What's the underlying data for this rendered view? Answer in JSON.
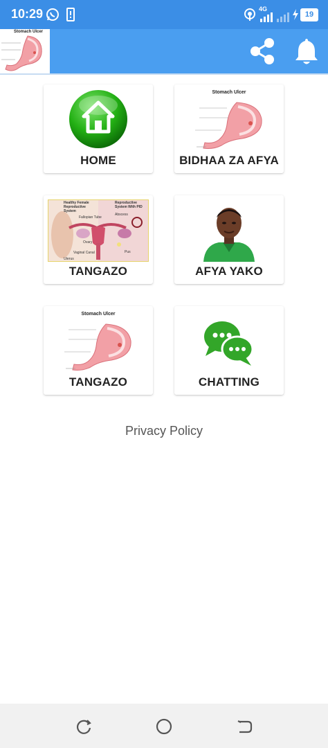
{
  "status_bar": {
    "time": "10:29",
    "network": "4G",
    "battery": "19",
    "icons": [
      "whatsapp-icon",
      "sim-alert-icon",
      "hotspot-icon",
      "signal-icon",
      "charging-icon",
      "battery-icon"
    ]
  },
  "app_bar": {
    "logo": {
      "title": "Stomach Ulcer",
      "icon": "stomach-ulcer-logo"
    },
    "actions": [
      {
        "name": "share",
        "icon": "share-icon"
      },
      {
        "name": "notifications",
        "icon": "bell-icon"
      }
    ],
    "color": "#4a9ef0"
  },
  "tiles": [
    {
      "label": "HOME",
      "icon": "home-icon"
    },
    {
      "label": "BIDHAA ZA AFYA",
      "icon": "stomach-ulcer-illustration",
      "image_title": "Stomach Ulcer"
    },
    {
      "label": "TANGAZO",
      "icon": "reproductive-system-illustration",
      "image_title_left": "Healthy Female Reproductive System",
      "image_title_right": "Reproductive System With PID",
      "image_labels": [
        "Fallopian Tube",
        "Ovary",
        "Vaginal Canal",
        "Uterus",
        "Abscess",
        "Pus"
      ]
    },
    {
      "label": "AFYA YAKO",
      "icon": "person-photo"
    },
    {
      "label": "TANGAZO",
      "icon": "stomach-ulcer-illustration",
      "image_title": "Stomach Ulcer"
    },
    {
      "label": "CHATTING",
      "icon": "chat-bubbles-icon"
    }
  ],
  "privacy_policy": "Privacy Policy",
  "nav_bar": {
    "buttons": [
      {
        "name": "recent",
        "icon": "recent-apps-icon"
      },
      {
        "name": "home",
        "icon": "home-circle-icon"
      },
      {
        "name": "back",
        "icon": "back-icon"
      }
    ]
  }
}
